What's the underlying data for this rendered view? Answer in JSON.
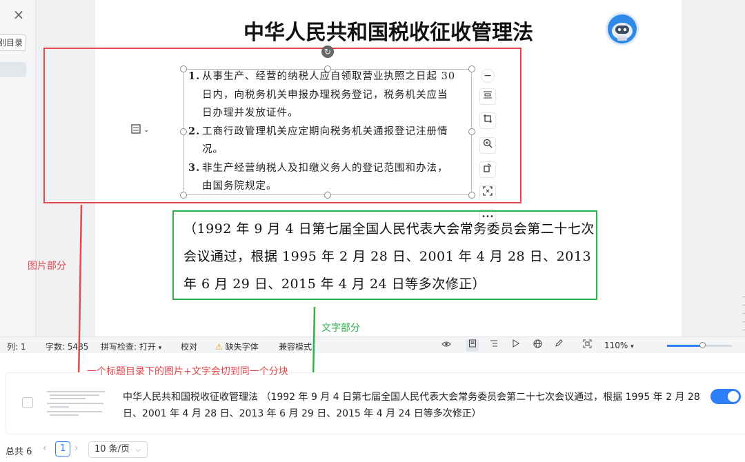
{
  "sidebar": {
    "close_icon": "×",
    "directory_button": "别目录"
  },
  "document": {
    "title": "中华人民共和国税收征收管理法",
    "image_list": [
      {
        "num": "1.",
        "text": "从事生产、经营的纳税人应自领取营业执照之日起 30 日内，向税务机关申报办理税务登记，税务机关应当日办理并发放证件。"
      },
      {
        "num": "2.",
        "text": "工商行政管理机关应定期向税务机关通报登记注册情况。"
      },
      {
        "num": "3.",
        "text": "非生产经营纳税人及扣缴义务人的登记范围和办法，由国务院规定。"
      }
    ],
    "paragraph": "（1992 年 9 月 4 日第七届全国人民代表大会常务委员会第二十七次会议通过，根据 1995 年 2 月 28 日、2001 年 4 月 28 日、2013 年 6 月 29 日、2015 年 4 月 24 日等多次修正）"
  },
  "image_toolbar": {
    "icons": [
      "minus-circle-icon",
      "text-wrap-icon",
      "crop-icon",
      "zoom-in-icon",
      "rotate-icon",
      "fit-icon",
      "more-icon"
    ],
    "more_glyph": "•••"
  },
  "annotations": {
    "image_part": "图片部分",
    "text_part": "文字部分",
    "chunk_note": "一个标题目录下的图片+文字会切到同一个分块"
  },
  "statusbar": {
    "column": "列: 1",
    "word_count": "字数: 5485",
    "spell_check": "拼写检查: 打开",
    "proofread": "校对",
    "missing_font": "缺失字体",
    "compat_mode": "兼容模式",
    "zoom": "110%",
    "zoom_fraction": 0.55,
    "warning_glyph": "⚠"
  },
  "chunk": {
    "text": "中华人民共和国税收征收管理法 （1992 年 9 月 4 日第七届全国人民代表大会常务委员会第二十七次会议通过，根据 1995 年 2 月 28 日、2001 年 4 月 28 日、2013 年 6 月 29 日、2015 年 4 月 24 日等多次修正）",
    "enabled": true
  },
  "pagination": {
    "total": "总共 6",
    "current_page": "1",
    "page_size": "10 条/页",
    "prev_glyph": "‹",
    "next_glyph": "›",
    "chevron": "⌵"
  },
  "colors": {
    "red_annotation": "#e5484d",
    "green_annotation": "#2db24e",
    "accent": "#2d7ff9"
  }
}
